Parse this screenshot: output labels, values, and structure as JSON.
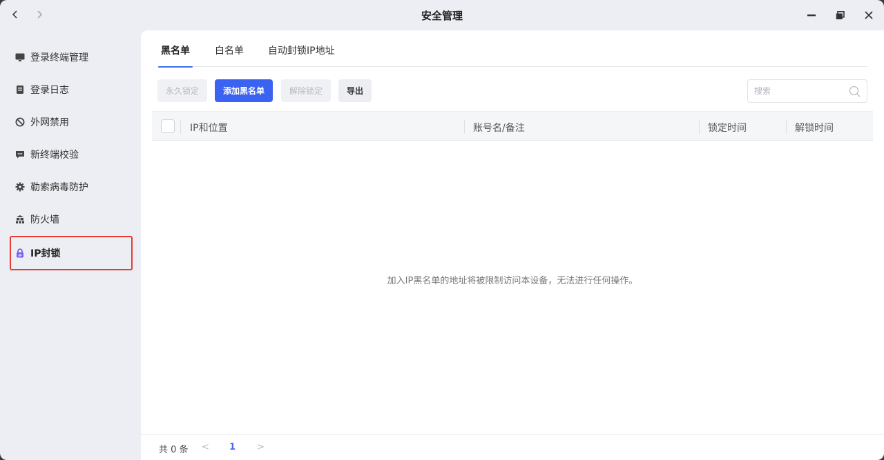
{
  "window": {
    "title": "安全管理",
    "nav": {
      "back_icon": "chevron-left-icon",
      "forward_icon": "chevron-right-icon"
    },
    "controls": {
      "minimize_icon": "minimize-icon",
      "restore_icon": "restore-icon",
      "close_icon": "close-icon"
    }
  },
  "sidebar": {
    "items": [
      {
        "label": "登录终端管理",
        "icon": "monitor-icon",
        "active": false
      },
      {
        "label": "登录日志",
        "icon": "log-icon",
        "active": false
      },
      {
        "label": "外网禁用",
        "icon": "ban-icon",
        "active": false
      },
      {
        "label": "新终端校验",
        "icon": "message-icon",
        "active": false
      },
      {
        "label": "勒索病毒防护",
        "icon": "gear-icon",
        "active": false
      },
      {
        "label": "防火墙",
        "icon": "firewall-icon",
        "active": false
      },
      {
        "label": "IP封锁",
        "icon": "lock-icon",
        "active": true
      }
    ]
  },
  "tabs": [
    {
      "label": "黑名单",
      "active": true
    },
    {
      "label": "白名单",
      "active": false
    },
    {
      "label": "自动封锁IP地址",
      "active": false
    }
  ],
  "toolbar": {
    "permanent_lock": "永久锁定",
    "add_blacklist": "添加黑名单",
    "unlock": "解除锁定",
    "export": "导出"
  },
  "search": {
    "placeholder": "搜索",
    "value": ""
  },
  "table": {
    "columns": [
      "IP和位置",
      "账号名/备注",
      "锁定时间",
      "解锁时间"
    ],
    "rows": []
  },
  "empty_message": "加入IP黑名单的地址将被限制访问本设备，无法进行任何操作。",
  "pagination": {
    "total": "共 0 条",
    "current_page": "1"
  },
  "colors": {
    "accent": "#3b63f2",
    "highlight_border": "#e63a32"
  }
}
